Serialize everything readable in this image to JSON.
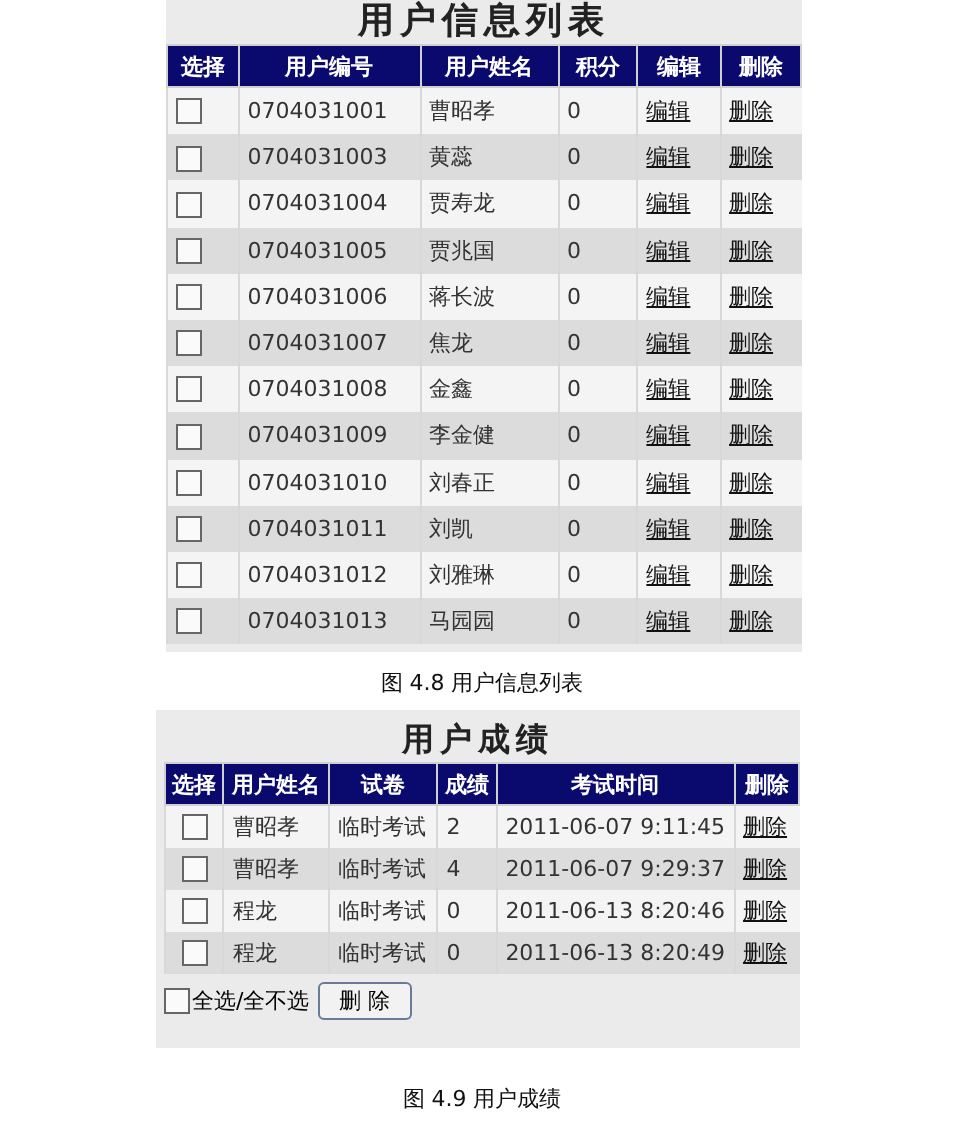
{
  "user_list": {
    "title": "用户信息列表",
    "columns": [
      "选择",
      "用户编号",
      "用户姓名",
      "积分",
      "编辑",
      "删除"
    ],
    "rows": [
      {
        "checked": false,
        "id": "0704031001",
        "name": "曹昭孝",
        "score": "0",
        "edit": "编辑",
        "delete": "删除"
      },
      {
        "checked": false,
        "id": "0704031003",
        "name": "黄蕊",
        "score": "0",
        "edit": "编辑",
        "delete": "删除"
      },
      {
        "checked": false,
        "id": "0704031004",
        "name": "贾寿龙",
        "score": "0",
        "edit": "编辑",
        "delete": "删除"
      },
      {
        "checked": false,
        "id": "0704031005",
        "name": "贾兆国",
        "score": "0",
        "edit": "编辑",
        "delete": "删除"
      },
      {
        "checked": false,
        "id": "0704031006",
        "name": "蒋长波",
        "score": "0",
        "edit": "编辑",
        "delete": "删除"
      },
      {
        "checked": false,
        "id": "0704031007",
        "name": "焦龙",
        "score": "0",
        "edit": "编辑",
        "delete": "删除"
      },
      {
        "checked": false,
        "id": "0704031008",
        "name": "金鑫",
        "score": "0",
        "edit": "编辑",
        "delete": "删除"
      },
      {
        "checked": false,
        "id": "0704031009",
        "name": "李金健",
        "score": "0",
        "edit": "编辑",
        "delete": "删除"
      },
      {
        "checked": false,
        "id": "0704031010",
        "name": "刘春正",
        "score": "0",
        "edit": "编辑",
        "delete": "删除"
      },
      {
        "checked": false,
        "id": "0704031011",
        "name": "刘凯",
        "score": "0",
        "edit": "编辑",
        "delete": "删除"
      },
      {
        "checked": false,
        "id": "0704031012",
        "name": "刘雅琳",
        "score": "0",
        "edit": "编辑",
        "delete": "删除"
      },
      {
        "checked": false,
        "id": "0704031013",
        "name": "马园园",
        "score": "0",
        "edit": "编辑",
        "delete": "删除"
      }
    ],
    "caption": "图 4.8  用户信息列表"
  },
  "user_scores": {
    "title": "用户成绩",
    "columns": [
      "选择",
      "用户姓名",
      "试卷",
      "成绩",
      "考试时间",
      "删除"
    ],
    "rows": [
      {
        "checked": false,
        "name": "曹昭孝",
        "paper": "临时考试",
        "score": "2",
        "time": "2011-06-07 9:11:45",
        "delete": "删除"
      },
      {
        "checked": false,
        "name": "曹昭孝",
        "paper": "临时考试",
        "score": "4",
        "time": "2011-06-07 9:29:37",
        "delete": "删除"
      },
      {
        "checked": false,
        "name": "程龙",
        "paper": "临时考试",
        "score": "0",
        "time": "2011-06-13 8:20:46",
        "delete": "删除"
      },
      {
        "checked": false,
        "name": "程龙",
        "paper": "临时考试",
        "score": "0",
        "time": "2011-06-13 8:20:49",
        "delete": "删除"
      }
    ],
    "select_all": {
      "label": "全选/全不选",
      "checked": false
    },
    "delete_button": "删  除",
    "caption": "图 4.9  用户成绩"
  }
}
